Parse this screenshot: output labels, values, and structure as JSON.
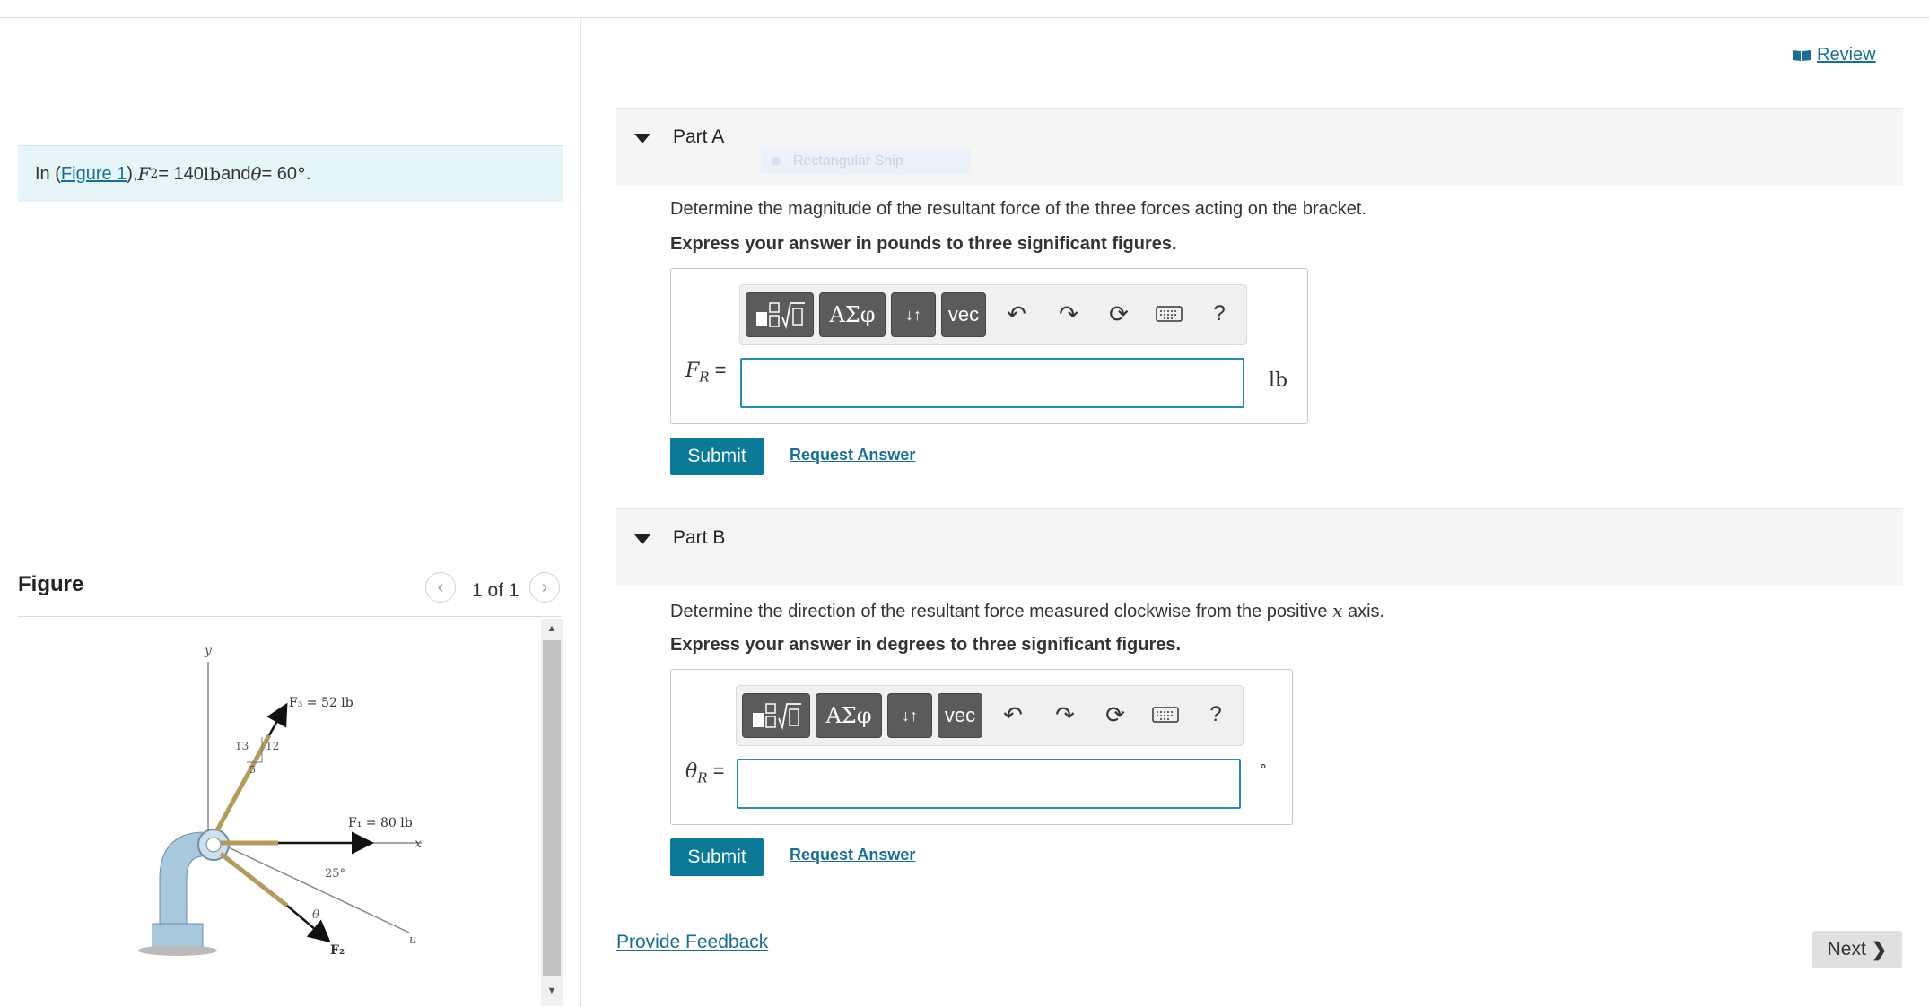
{
  "intro": {
    "prefix": "In (",
    "figure_link": "Figure 1",
    "after_link": "), ",
    "f2_symbol": "F",
    "f2_sub": "2",
    "f2_value": " = 140 ",
    "f2_unit": "lb",
    "and_text": " and ",
    "theta_symbol": "θ",
    "theta_value": " = 60",
    "theta_unit": "°",
    "end": "."
  },
  "figure_panel": {
    "title": "Figure",
    "prev_icon": "chevron-left-icon",
    "next_icon": "chevron-right-icon",
    "count": "1 of 1",
    "labels": {
      "y": "y",
      "x": "x",
      "u": "u",
      "f3": "F₃ = 52 lb",
      "f1": "F₁ = 80 lb",
      "f2": "F₂",
      "n13": "13",
      "n12": "12",
      "n5": "5",
      "a25": "25°",
      "theta": "θ"
    }
  },
  "review": {
    "icon": "book-icon",
    "label": "Review"
  },
  "ghost_snip": "Rectangular Snip",
  "parts": [
    {
      "title": "Part A",
      "question": "Determine the magnitude of the resultant force of the three forces acting on the bracket.",
      "instruction": "Express your answer in pounds to three significant figures.",
      "var_symbol": "F",
      "var_sub": "R",
      "var_eq": " =",
      "unit": "lb",
      "input_value": "",
      "submit": "Submit",
      "request": "Request Answer"
    },
    {
      "title": "Part B",
      "question_pre": "Determine the direction of the resultant force measured clockwise from the positive ",
      "question_var": "x",
      "question_post": " axis.",
      "instruction": "Express your answer in degrees to three significant figures.",
      "var_symbol": "θ",
      "var_sub": "R",
      "var_eq": " =",
      "unit": "°",
      "input_value": "",
      "submit": "Submit",
      "request": "Request Answer"
    }
  ],
  "toolbar": {
    "templates_icon": "fraction-sqrt-templates-icon",
    "greek": "ΑΣφ",
    "arrows": "↓↑",
    "vec": "vec",
    "undo_icon": "undo-icon",
    "redo_icon": "redo-icon",
    "reset_icon": "reset-icon",
    "keyboard_icon": "keyboard-icon",
    "help": "?"
  },
  "footer": {
    "feedback": "Provide Feedback",
    "next": "Next"
  },
  "colors": {
    "accent": "#0b7a99",
    "link": "#1a6e92",
    "intro_bg": "#e6f5f7",
    "input_border": "#2a8da8"
  }
}
